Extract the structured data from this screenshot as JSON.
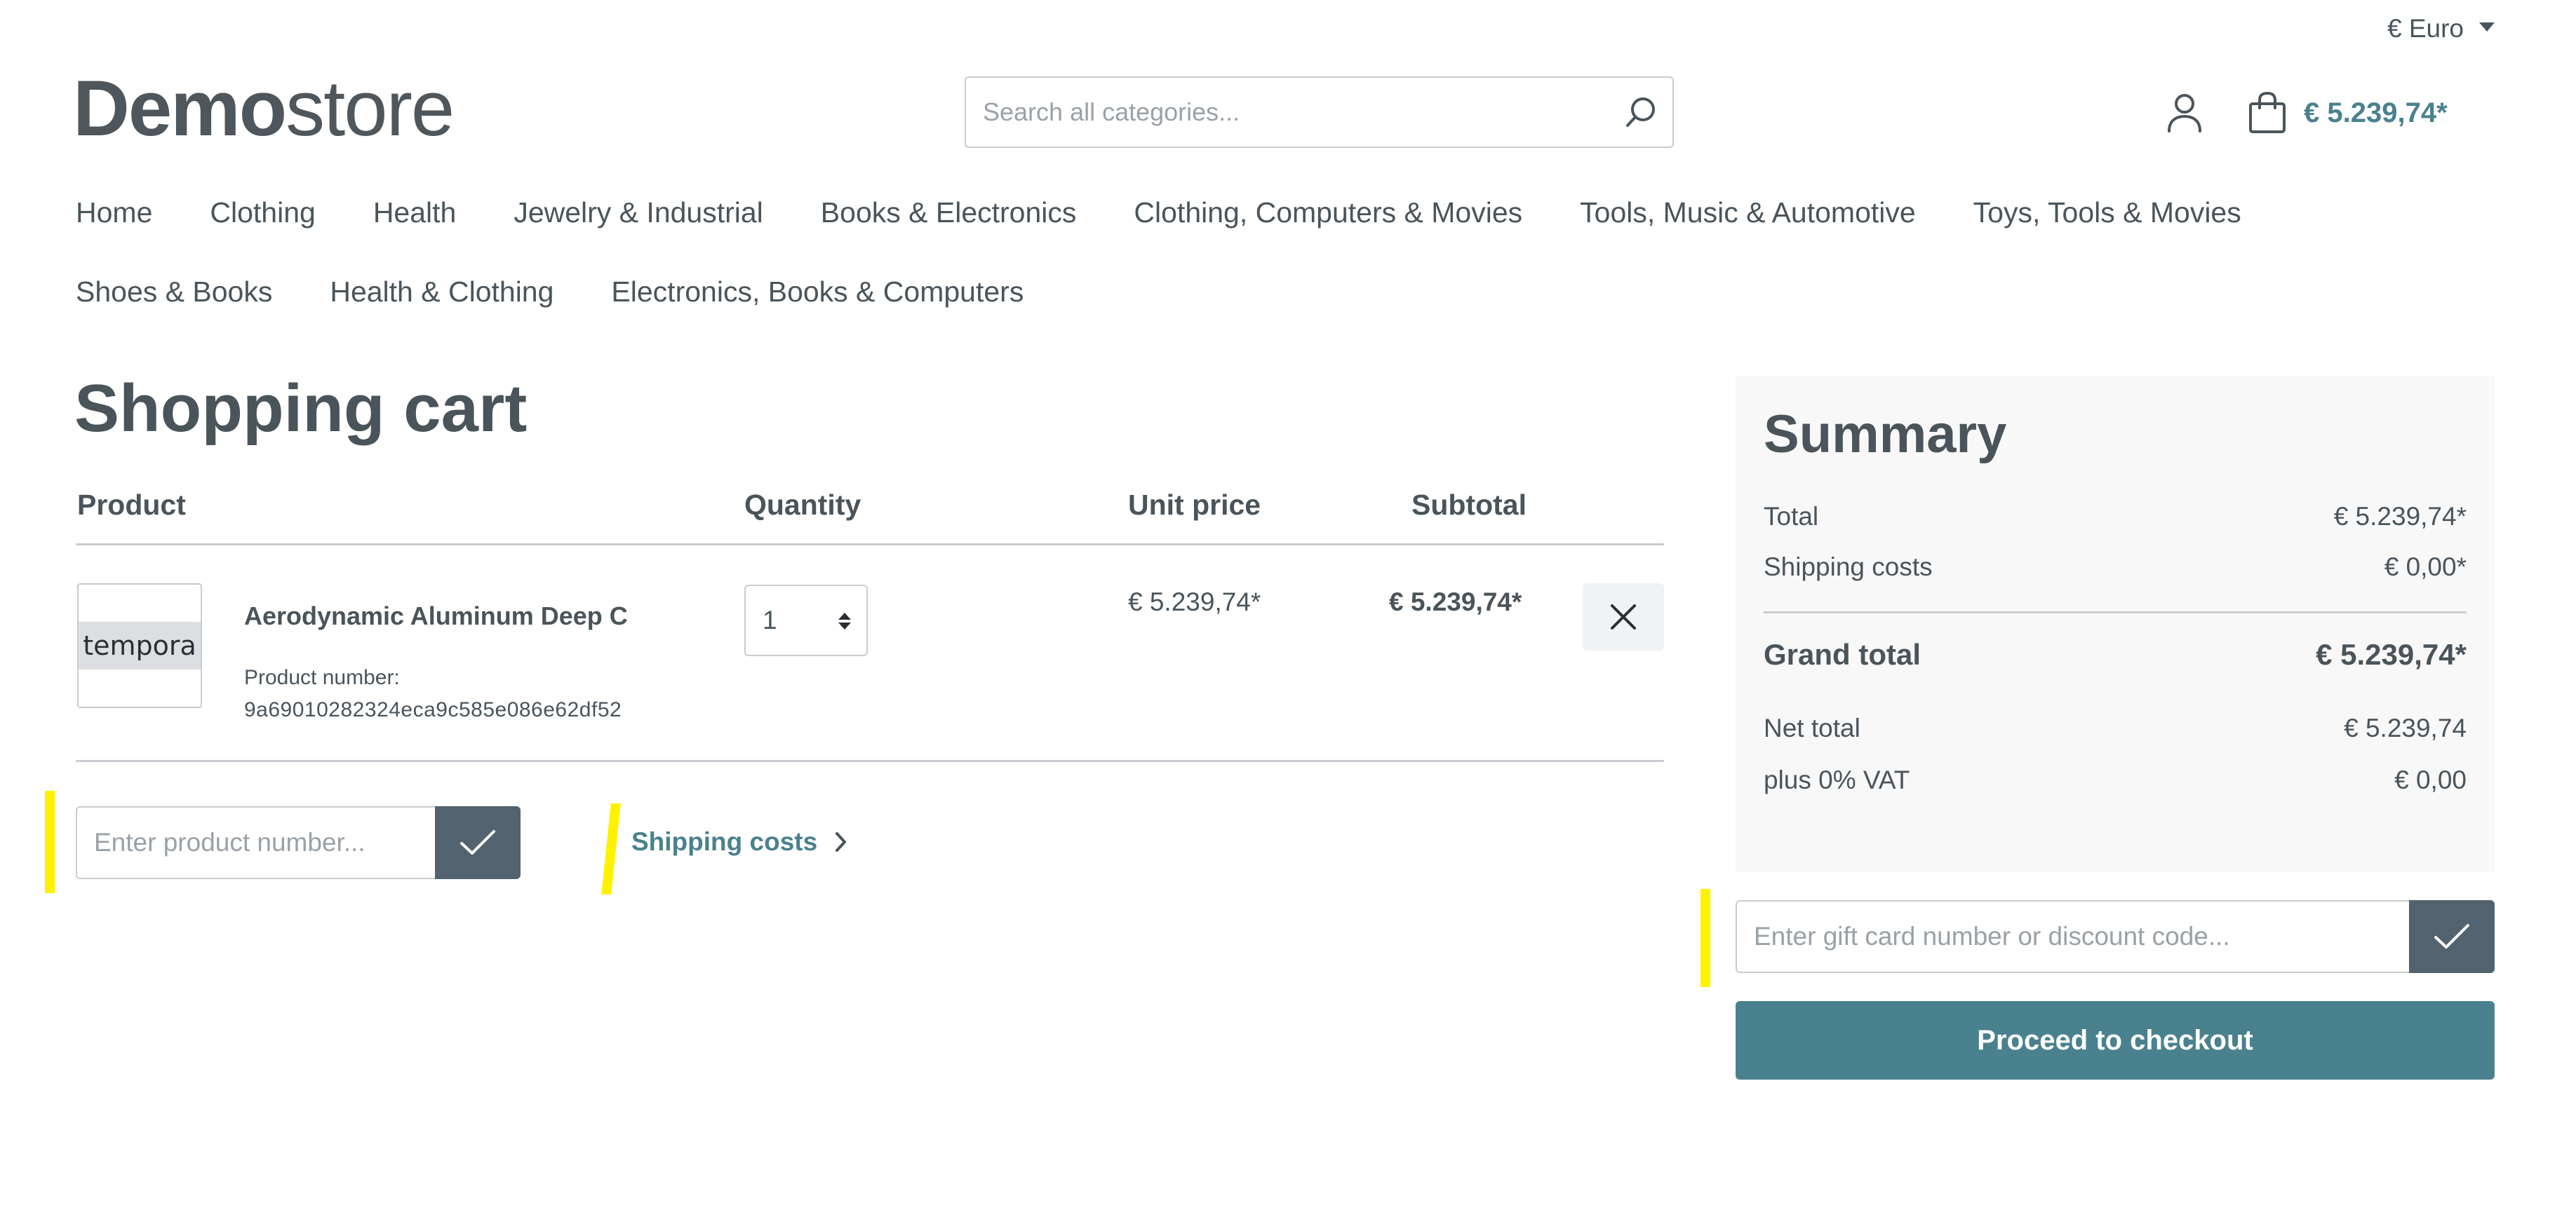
{
  "header": {
    "currency": "€ Euro",
    "logo_bold": "Demo",
    "logo_light": "store",
    "search_placeholder": "Search all categories...",
    "cart_total": "€ 5.239,74*"
  },
  "nav": {
    "row1": [
      "Home",
      "Clothing",
      "Health",
      "Jewelry & Industrial",
      "Books & Electronics",
      "Clothing, Computers & Movies",
      "Tools, Music & Automotive",
      "Toys, Tools & Movies"
    ],
    "row2": [
      "Shoes & Books",
      "Health & Clothing",
      "Electronics, Books & Computers"
    ]
  },
  "cart": {
    "title": "Shopping cart",
    "columns": {
      "product": "Product",
      "quantity": "Quantity",
      "unit_price": "Unit price",
      "subtotal": "Subtotal"
    },
    "item": {
      "thumb_text": "tempora",
      "name": "Aerodynamic Aluminum Deep C",
      "number_label": "Product number:",
      "number": "9a69010282324eca9c585e086e62df52",
      "quantity": "1",
      "unit_price": "€ 5.239,74*",
      "subtotal": "€ 5.239,74*"
    },
    "add_product_placeholder": "Enter product number...",
    "shipping_link": "Shipping costs"
  },
  "summary": {
    "title": "Summary",
    "total_label": "Total",
    "total_value": "€ 5.239,74*",
    "shipping_label": "Shipping costs",
    "shipping_value": "€ 0,00*",
    "grand_label": "Grand total",
    "grand_value": "€ 5.239,74*",
    "net_label": "Net total",
    "net_value": "€ 5.239,74",
    "vat_label": "plus 0% VAT",
    "vat_value": "€ 0,00",
    "gift_placeholder": "Enter gift card number or discount code...",
    "checkout_label": "Proceed to checkout"
  },
  "colors": {
    "accent": "#4a818e",
    "text": "#4a545b",
    "dark_button": "#52636f",
    "highlight": "#fff200"
  }
}
